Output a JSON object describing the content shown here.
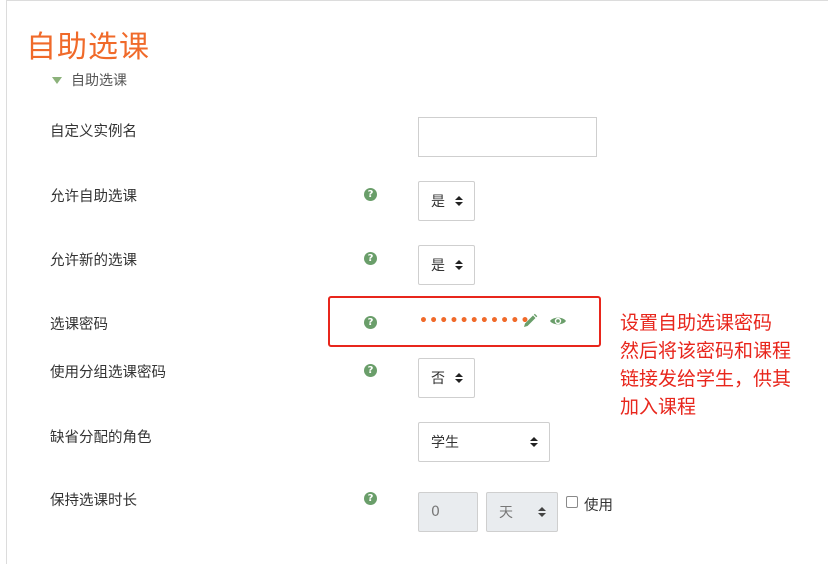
{
  "page": {
    "title": "自助选课",
    "section": "自助选课"
  },
  "fields": {
    "instance_name": {
      "label": "自定义实例名",
      "value": ""
    },
    "allow_self_enrol": {
      "label": "允许自助选课",
      "value": "是"
    },
    "allow_new_enrol": {
      "label": "允许新的选课",
      "value": "是"
    },
    "enrol_key": {
      "label": "选课密码",
      "value_masked": "•••••••••••"
    },
    "use_group_key": {
      "label": "使用分组选课密码",
      "value": "否"
    },
    "default_role": {
      "label": "缺省分配的角色",
      "value": "学生"
    },
    "enrol_period": {
      "label": "保持选课时长",
      "number": "0",
      "unit": "天",
      "enable_label": "使用",
      "enabled": false
    }
  },
  "annotation": {
    "lines": [
      "设置自助选课密码",
      "然后将该密码和课程",
      "链接发给学生，供其",
      "加入课程"
    ],
    "color": "#e8261c"
  },
  "colors": {
    "title": "#f06a2a",
    "help_icon": "#6a9e6a",
    "icon_green": "#6a9e6a"
  },
  "icons": {
    "help": "question-circle-icon",
    "edit": "pencil-icon",
    "reveal": "eye-icon",
    "collapse": "caret-down-icon"
  }
}
